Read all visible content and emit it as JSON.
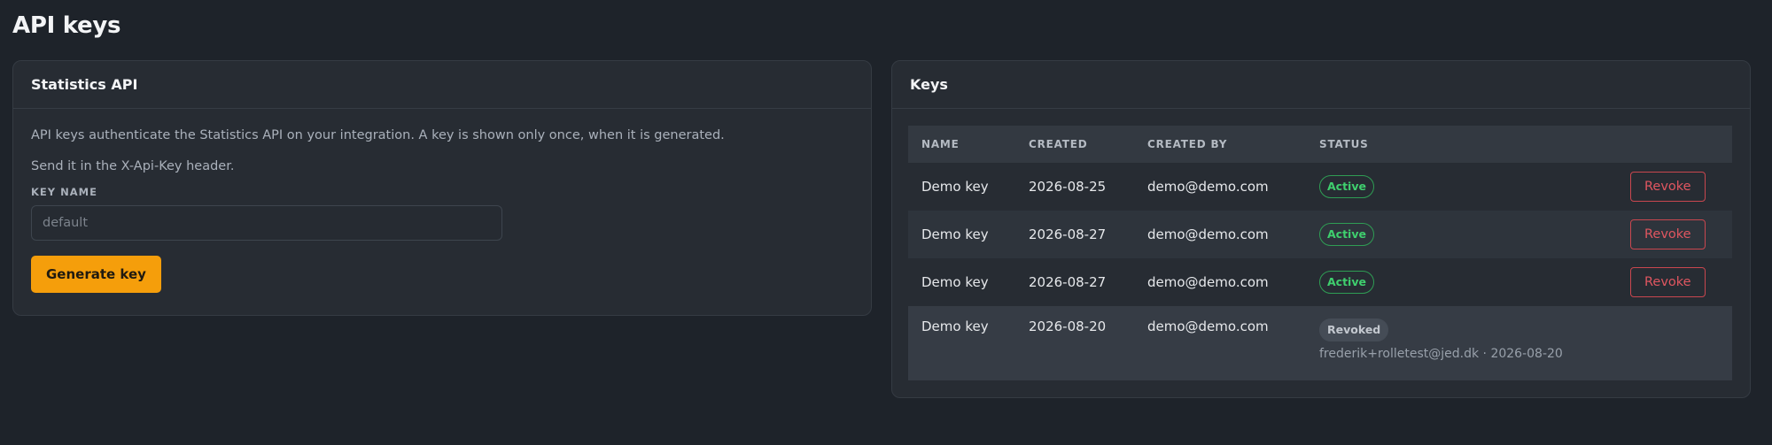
{
  "page": {
    "title": "API keys"
  },
  "statistics_card": {
    "title": "Statistics API",
    "description_1": "API keys authenticate the Statistics API on your integration. A key is shown only once, when it is generated.",
    "description_2": "Send it in the X-Api-Key header.",
    "key_name_label": "KEY NAME",
    "key_name_value": "",
    "key_name_placeholder": "default",
    "generate_label": "Generate key"
  },
  "keys_card": {
    "title": "Keys",
    "columns": {
      "name": "NAME",
      "created": "CREATED",
      "created_by": "CREATED BY",
      "status": "STATUS"
    },
    "revoke_label": "Revoke",
    "rows": [
      {
        "name": "Demo key",
        "created": "2026-08-25",
        "created_by": "demo@demo.com",
        "status": "Active"
      },
      {
        "name": "Demo key",
        "created": "2026-08-27",
        "created_by": "demo@demo.com",
        "status": "Active"
      },
      {
        "name": "Demo key",
        "created": "2026-08-27",
        "created_by": "demo@demo.com",
        "status": "Active"
      },
      {
        "name": "Demo key",
        "created": "2026-08-20",
        "created_by": "demo@demo.com",
        "status": "Revoked",
        "revoked_info": "frederik+rolletest@jed.dk · 2026-08-20"
      }
    ]
  },
  "colors": {
    "background": "#1e232a",
    "card": "#272c33",
    "accent": "#f59e0b",
    "active": "#3fcf6e",
    "danger": "#e05660"
  }
}
